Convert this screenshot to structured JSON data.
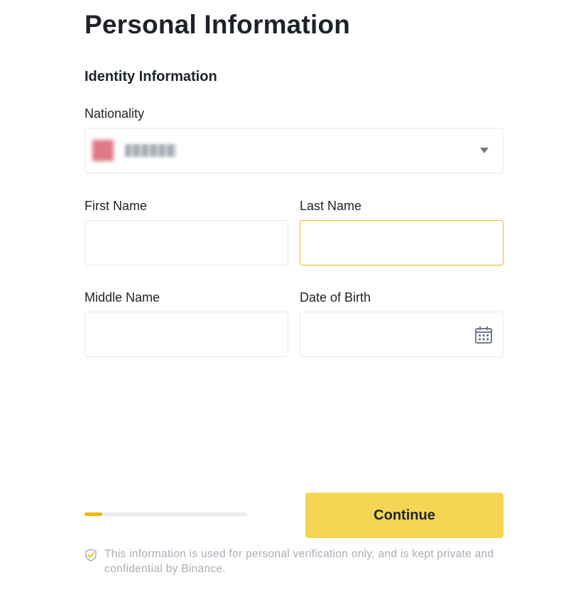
{
  "header": {
    "title": "Personal Information"
  },
  "section": {
    "title": "Identity Information"
  },
  "nationality": {
    "label": "Nationality",
    "selected_value": "",
    "flag_icon": "flag-icon",
    "dropdown_icon": "chevron-down-icon"
  },
  "fields": {
    "first_name": {
      "label": "First Name",
      "value": "",
      "placeholder": ""
    },
    "last_name": {
      "label": "Last Name",
      "value": "",
      "placeholder": ""
    },
    "middle_name": {
      "label": "Middle Name",
      "value": "",
      "placeholder": ""
    },
    "date_of_birth": {
      "label": "Date of Birth",
      "value": "",
      "placeholder": "",
      "icon": "calendar-icon"
    }
  },
  "progress": {
    "fraction": 0.11
  },
  "actions": {
    "continue_label": "Continue"
  },
  "notice": {
    "icon": "shield-check-icon",
    "text": "This information is used for personal verification only, and is kept private and confidential by Binance."
  },
  "colors": {
    "accent": "#f0b90b",
    "button": "#f4d654",
    "text": "#1e2329",
    "muted": "#a8aeb6",
    "border": "#e6e8ea"
  }
}
